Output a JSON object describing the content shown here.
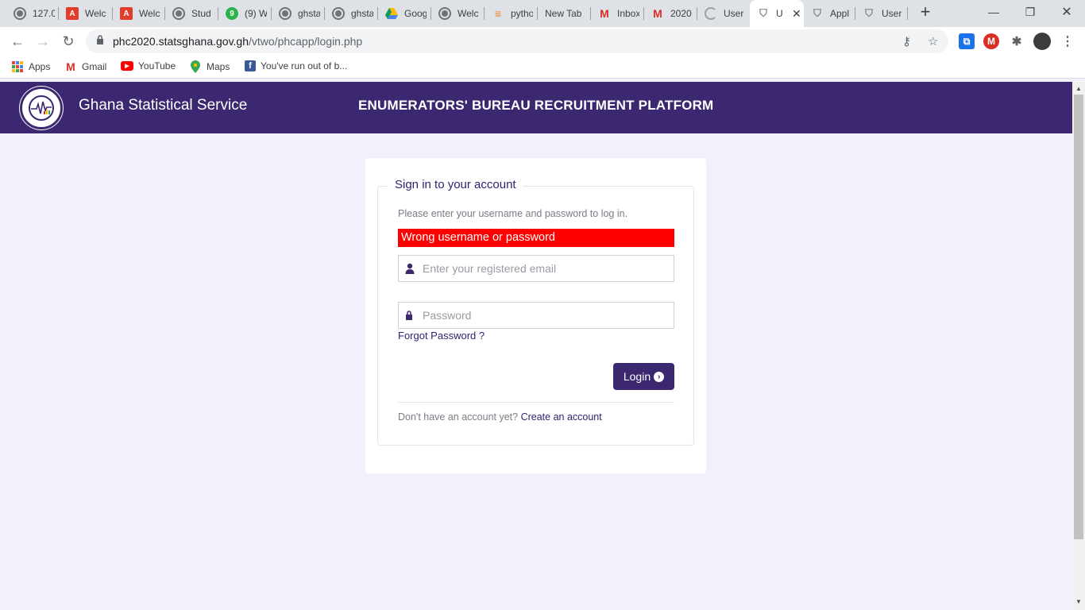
{
  "browser": {
    "tabs": [
      {
        "label": "127.0",
        "icon": "globe-icon"
      },
      {
        "label": "Welc",
        "icon": "acrobat-icon"
      },
      {
        "label": "Welc",
        "icon": "acrobat-icon"
      },
      {
        "label": "Stud",
        "icon": "globe-icon"
      },
      {
        "label": "(9) W",
        "icon": "whatsapp-icon"
      },
      {
        "label": "ghsta",
        "icon": "globe-icon"
      },
      {
        "label": "ghsta",
        "icon": "globe-icon"
      },
      {
        "label": "Goog",
        "icon": "drive-icon"
      },
      {
        "label": "Welc",
        "icon": "globe-icon"
      },
      {
        "label": "pytho",
        "icon": "stackoverflow-icon"
      },
      {
        "label": "New Tab",
        "icon": ""
      },
      {
        "label": "Inbox",
        "icon": "gmail-icon"
      },
      {
        "label": "2020",
        "icon": "gmail-icon"
      },
      {
        "label": "User",
        "icon": "loading-icon"
      },
      {
        "label": "U",
        "icon": "shield-icon",
        "active": true
      },
      {
        "label": "Appl",
        "icon": "shield-icon"
      },
      {
        "label": "User",
        "icon": "shield-icon"
      }
    ],
    "url_host": "phc2020.statsghana.gov.gh",
    "url_path": "/vtwo/phcapp/login.php",
    "bookmarks": [
      {
        "label": "Apps",
        "icon": "apps-icon"
      },
      {
        "label": "Gmail",
        "icon": "gmail-icon"
      },
      {
        "label": "YouTube",
        "icon": "youtube-icon"
      },
      {
        "label": "Maps",
        "icon": "maps-icon"
      },
      {
        "label": "You've run out of b...",
        "icon": "facebook-icon"
      }
    ]
  },
  "header": {
    "site_name": "Ghana Statistical Service",
    "platform_title": "ENUMERATORS' BUREAU RECRUITMENT PLATFORM",
    "brand_color": "#3b2870"
  },
  "login": {
    "legend": "Sign in to your account",
    "instruction": "Please enter your username and password to log in.",
    "error": "Wrong username or password",
    "error_color": "#ff0000",
    "email_placeholder": "Enter your registered email",
    "password_placeholder": "Password",
    "forgot_label": "Forgot Password ?",
    "login_label": "Login",
    "signup_prompt": "Don't have an account yet?",
    "signup_link": "Create an account"
  }
}
